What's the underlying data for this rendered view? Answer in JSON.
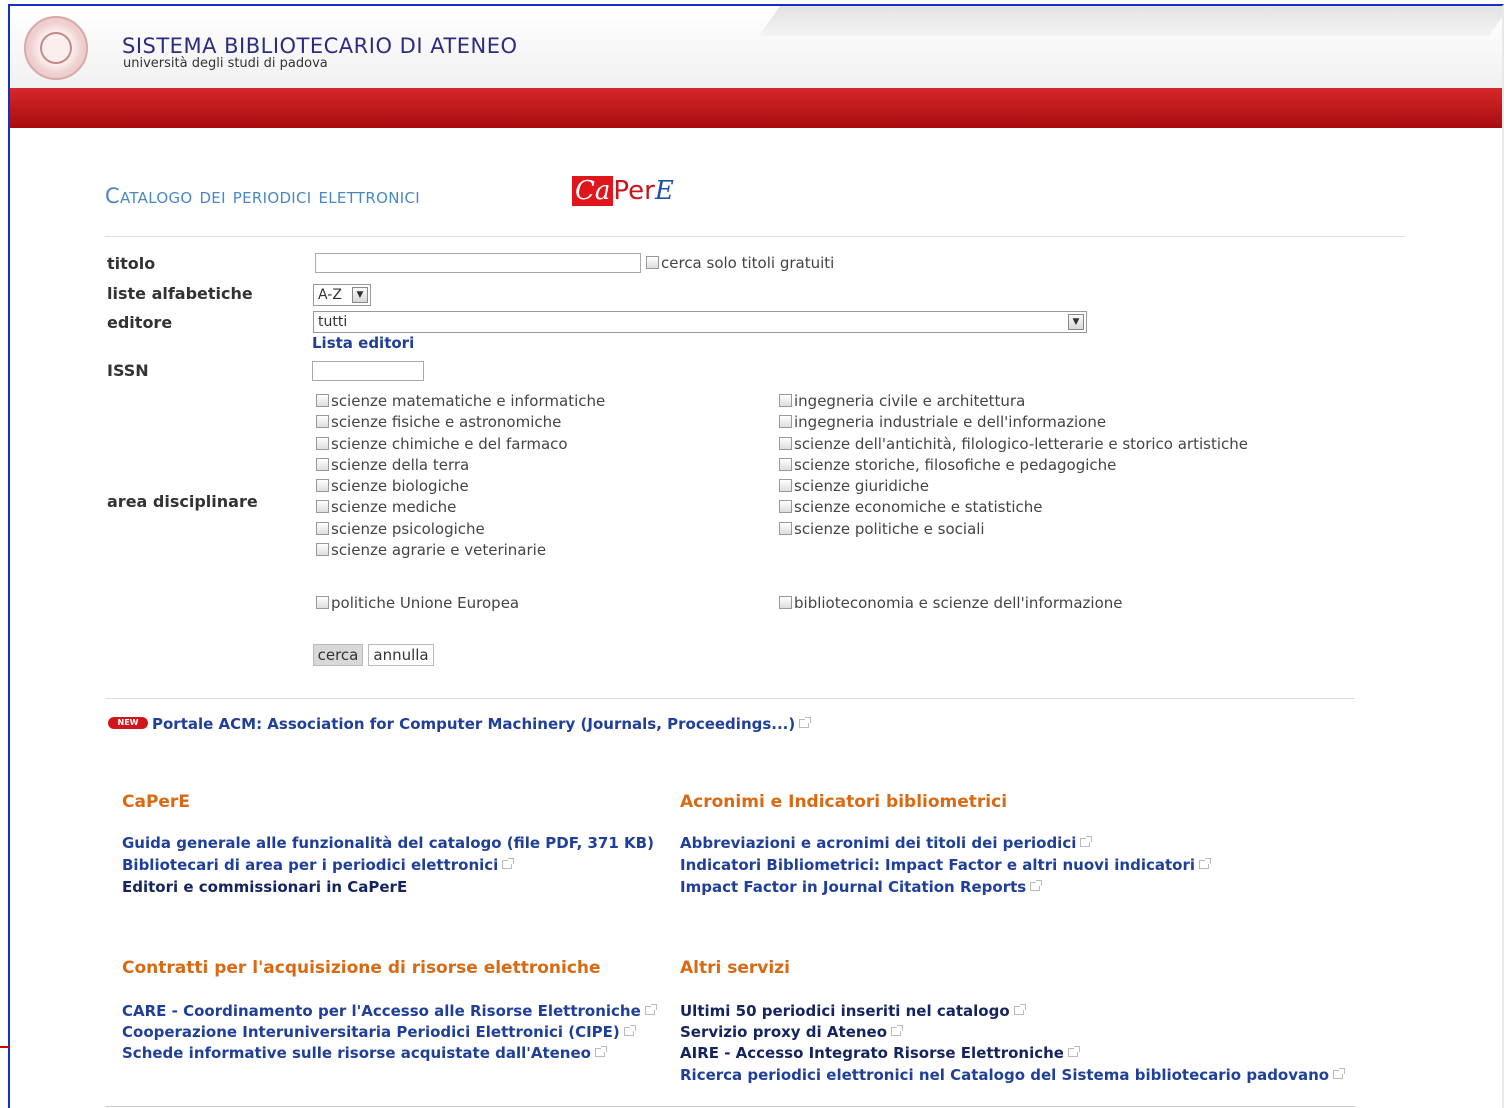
{
  "header": {
    "title": "SISTEMA BIBLIOTECARIO DI ATENEO",
    "subtitle": "università degli studi di padova"
  },
  "catalog": {
    "title": "Catalogo dei periodici elettronici",
    "logo_ca": "Ca",
    "logo_per": "Per",
    "logo_e": "E"
  },
  "form": {
    "titolo_label": "titolo",
    "titolo_value": "",
    "free_only_label": "cerca solo titoli gratuiti",
    "liste_label": "liste alfabetiche",
    "liste_value": "A-Z",
    "editore_label": "editore",
    "editore_value": "tutti",
    "lista_editori_link": "Lista editori",
    "issn_label": "ISSN",
    "issn_value": "",
    "area_label": "area disciplinare",
    "areas_left": [
      "scienze matematiche e informatiche",
      "scienze fisiche e astronomiche",
      "scienze chimiche e del farmaco",
      "scienze della terra",
      "scienze biologiche",
      "scienze mediche",
      "scienze psicologiche",
      "scienze agrarie e veterinarie"
    ],
    "areas_right": [
      "ingegneria civile e architettura",
      "ingegneria industriale e dell'informazione",
      "scienze dell'antichità, filologico-letterarie e storico artistiche",
      "scienze storiche, filosofiche e pedagogiche",
      "scienze giuridiche",
      "scienze economiche e statistiche",
      "scienze politiche e sociali"
    ],
    "extra_left": "politiche Unione Europea",
    "extra_right": "biblioteconomia e scienze dell'informazione",
    "search_button": "cerca",
    "cancel_button": "annulla"
  },
  "news": {
    "badge": "NEW",
    "link": "Portale ACM: Association for Computer Machinery (Journals, Proceedings...)"
  },
  "sections": {
    "capere": {
      "title": "CaPerE",
      "links": [
        "Guida generale alle funzionalità del catalogo (file PDF, 371 KB)",
        "Bibliotecari di area per i periodici elettronici",
        "Editori e commissionari in CaPerE"
      ]
    },
    "acronimi": {
      "title": "Acronimi e Indicatori bibliometrici",
      "links": [
        "Abbreviazioni e acronimi dei titoli dei periodici",
        "Indicatori Bibliometrici: Impact Factor e altri nuovi indicatori",
        "Impact Factor in Journal Citation Reports"
      ]
    },
    "contratti": {
      "title": "Contratti per l'acquisizione di risorse elettroniche",
      "links": [
        "CARE - Coordinamento per l'Accesso alle Risorse Elettroniche",
        "Cooperazione Interuniversitaria Periodici Elettronici (CIPE)",
        "Schede informative sulle risorse acquistate dall'Ateneo"
      ]
    },
    "altri": {
      "title": "Altri servizi",
      "links": [
        "Ultimi 50 periodici inseriti nel catalogo",
        "Servizio proxy di Ateneo",
        "AIRE - Accesso Integrato Risorse Elettroniche",
        "Ricerca periodici elettronici nel Catalogo del Sistema bibliotecario padovano"
      ]
    }
  }
}
